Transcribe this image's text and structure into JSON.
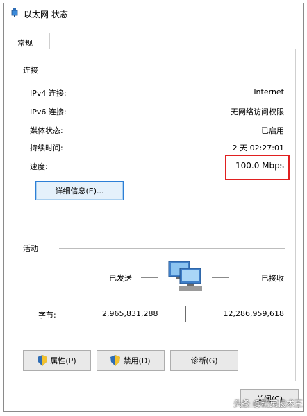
{
  "window": {
    "title": "以太网 状态"
  },
  "tabs": [
    {
      "label": "常规"
    }
  ],
  "connection": {
    "section_label": "连接",
    "rows": [
      {
        "label": "IPv4 连接:",
        "value": "Internet"
      },
      {
        "label": "IPv6 连接:",
        "value": "无网络访问权限"
      },
      {
        "label": "媒体状态:",
        "value": "已启用"
      },
      {
        "label": "持续时间:",
        "value": "2 天 02:27:01"
      },
      {
        "label": "速度:",
        "value": "100.0 Mbps"
      }
    ],
    "details_button": "详细信息(E)..."
  },
  "activity": {
    "section_label": "活动",
    "sent_label": "已发送",
    "received_label": "已接收",
    "bytes_label": "字节:",
    "bytes_sent": "2,965,831,288",
    "bytes_received": "12,286,959,618"
  },
  "buttons": {
    "properties": "属性(P)",
    "disable": "禁用(D)",
    "diagnose": "诊断(G)",
    "close": "关闭(C)"
  },
  "icons": {
    "title": "network-adapter-icon",
    "activity": "network-computers-icon",
    "shield": "uac-shield-icon"
  },
  "colors": {
    "highlight": "#e02020",
    "focus_border": "#2d7fd6"
  },
  "watermark": "头条 @精英技术王"
}
